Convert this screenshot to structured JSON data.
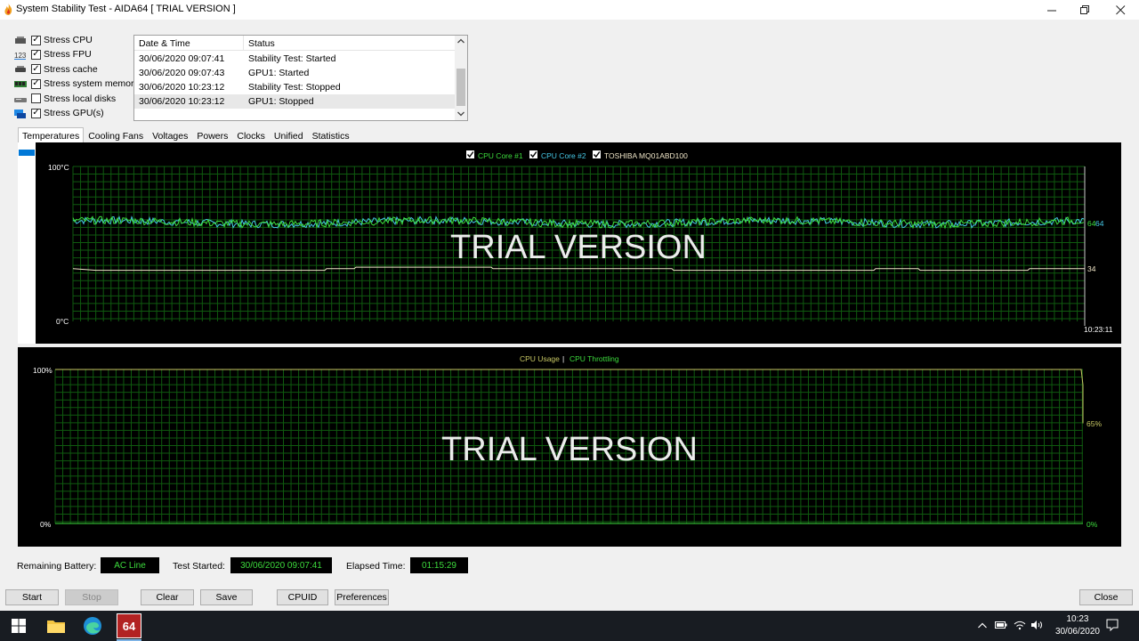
{
  "window": {
    "title": "System Stability Test - AIDA64  [ TRIAL VERSION ]"
  },
  "stress_options": [
    {
      "label": "Stress CPU",
      "checked": true,
      "icon": "cpu-icon"
    },
    {
      "label": "Stress FPU",
      "checked": true,
      "icon": "fpu-icon"
    },
    {
      "label": "Stress cache",
      "checked": true,
      "icon": "cache-icon"
    },
    {
      "label": "Stress system memory",
      "checked": true,
      "icon": "memory-icon"
    },
    {
      "label": "Stress local disks",
      "checked": false,
      "icon": "disk-icon"
    },
    {
      "label": "Stress GPU(s)",
      "checked": true,
      "icon": "gpu-icon"
    }
  ],
  "log": {
    "headers": {
      "datetime": "Date & Time",
      "status": "Status"
    },
    "rows": [
      {
        "datetime": "30/06/2020 09:07:41",
        "status": "Stability Test: Started"
      },
      {
        "datetime": "30/06/2020 09:07:43",
        "status": "GPU1: Started"
      },
      {
        "datetime": "30/06/2020 10:23:12",
        "status": "Stability Test: Stopped"
      },
      {
        "datetime": "30/06/2020 10:23:12",
        "status": "GPU1: Stopped"
      }
    ]
  },
  "tabs": [
    "Temperatures",
    "Cooling Fans",
    "Voltages",
    "Powers",
    "Clocks",
    "Unified",
    "Statistics"
  ],
  "active_tab": "Temperatures",
  "temp_graph": {
    "legend": [
      {
        "label": "CPU Core #1",
        "color": "#3ddc3d"
      },
      {
        "label": "CPU Core #2",
        "color": "#46c8e6"
      },
      {
        "label": "TOSHIBA MQ01ABD100",
        "color": "#f0e6c8"
      }
    ],
    "y_max_label": "100°C",
    "y_min_label": "0°C",
    "value_labels": [
      "64",
      "64",
      "34"
    ],
    "time_label": "10:23:11",
    "watermark": "TRIAL VERSION"
  },
  "usage_graph": {
    "legend_usage": "CPU Usage",
    "legend_sep": "|",
    "legend_throttling": "CPU Throttling",
    "y_max_label": "100%",
    "y_min_label": "0%",
    "current_usage_label": "65%",
    "current_throttle_label": "0%",
    "watermark": "TRIAL VERSION"
  },
  "status": {
    "battery_label": "Remaining Battery:",
    "battery_value": "AC Line",
    "started_label": "Test Started:",
    "started_value": "30/06/2020 09:07:41",
    "elapsed_label": "Elapsed Time:",
    "elapsed_value": "01:15:29"
  },
  "buttons": {
    "start": "Start",
    "stop": "Stop",
    "clear": "Clear",
    "save": "Save",
    "cpuid": "CPUID",
    "preferences": "Preferences",
    "close": "Close"
  },
  "taskbar": {
    "aida_label": "64",
    "time": "10:23",
    "date": "30/06/2020"
  },
  "colors": {
    "grid": "#0f5a0f",
    "core1": "#3ddc3d",
    "core2": "#46c8e6",
    "disk": "#f0e6c8",
    "usage": "#c8c864",
    "throttle": "#3ddc3d"
  }
}
